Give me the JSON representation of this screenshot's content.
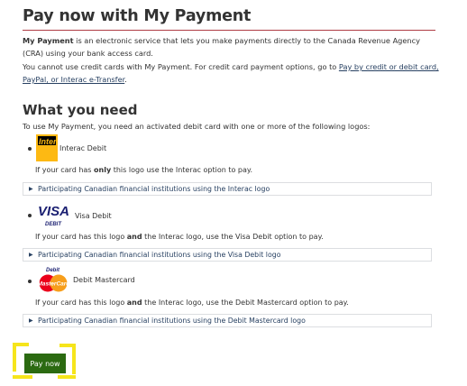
{
  "title": "Pay now with My Payment",
  "intro": {
    "bold": "My Payment",
    "rest": " is an electronic service that lets you make payments directly to the Canada Revenue Agency (CRA) using your bank access card."
  },
  "credit_note": {
    "text": "You cannot use credit cards with My Payment. For credit card payment options, go to ",
    "link": "Pay by credit or debit card, PayPal, or Interac e-Transfer",
    "end": "."
  },
  "section_title": "What you need",
  "section_intro": "To use My Payment, you need an activated debit card with one or more of the following logos:",
  "cards": [
    {
      "logo_text": "Interac",
      "label": "Interac Debit",
      "note_pre": "If your card has ",
      "note_bold": "only",
      "note_post": " this logo use the Interac option to pay.",
      "details": "Participating Canadian financial institutions using the Interac logo"
    },
    {
      "logo_text": "VISA",
      "logo_sub": "DEBIT",
      "label": "Visa Debit",
      "note_pre": "If your card has this logo ",
      "note_bold": "and",
      "note_post": " the Interac logo, use the Visa Debit option to pay.",
      "details": "Participating Canadian financial institutions using the Visa Debit logo"
    },
    {
      "logo_top": "Debit",
      "logo_text": "MasterCard",
      "label": "Debit Mastercard",
      "note_pre": "If your card has this logo ",
      "note_bold": "and",
      "note_post": " the Interac logo, use the Debit Mastercard option to pay.",
      "details": "Participating Canadian financial institutions using the Debit Mastercard logo"
    }
  ],
  "pay_button": "Pay now",
  "colors": {
    "title_rule": "#af3c43",
    "link": "#284162",
    "pay_button": "#2b6a11",
    "highlight": "#f6e51b"
  }
}
